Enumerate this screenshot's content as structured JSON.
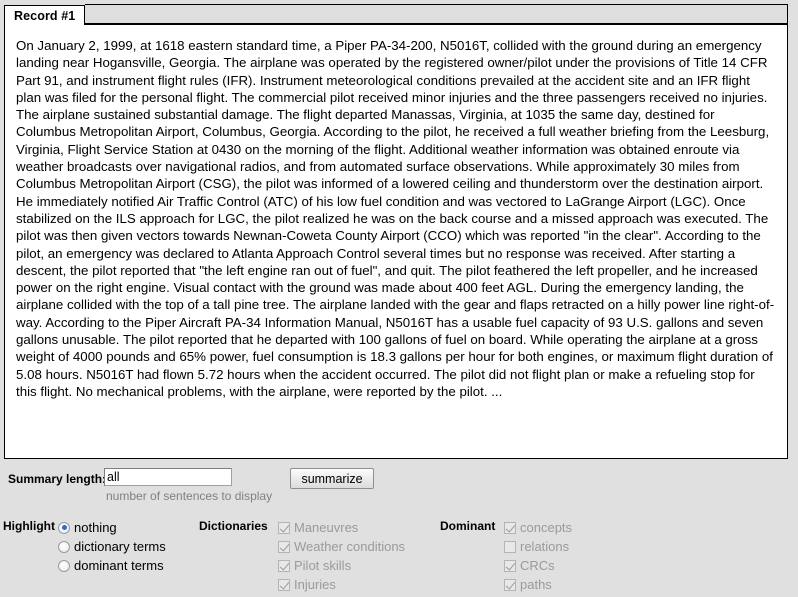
{
  "tab": {
    "label": "Record #1"
  },
  "record": {
    "text": "On January 2, 1999, at 1618 eastern standard time, a Piper PA-34-200, N5016T, collided with the ground during an emergency landing near Hogansville, Georgia. The airplane was operated by the registered owner/pilot under the provisions of Title 14 CFR Part 91, and instrument flight rules (IFR). Instrument meteorological conditions prevailed at the accident site and an IFR flight plan was filed for the personal flight. The commercial pilot received minor injuries and the three passengers received no injuries. The airplane sustained substantial damage. The flight departed Manassas, Virginia, at 1035 the same day, destined for Columbus Metropolitan Airport, Columbus, Georgia. According to the pilot, he received a full weather briefing from the Leesburg, Virginia, Flight Service Station at 0430 on the morning of the flight. Additional weather information was obtained enroute via weather broadcasts over navigational radios, and from automated surface observations. While approximately 30 miles from Columbus Metropolitan Airport (CSG), the pilot was informed of a lowered ceiling and thunderstorm over the destination airport. He immediately notified Air Traffic Control (ATC) of his low fuel condition and was vectored to LaGrange Airport (LGC). Once stabilized on the ILS approach for LGC, the pilot realized he was on the back course and a missed approach was executed. The pilot was then given vectors towards Newnan-Coweta County Airport (CCO) which was reported \"in the clear\". According to the pilot, an emergency was declared to Atlanta Approach Control several times but no response was received. After starting a descent, the pilot reported that \"the left engine ran out of fuel\", and quit. The pilot feathered the left propeller, and he increased power on the right engine. Visual contact with the ground was made about 400 feet AGL. During the emergency landing, the airplane collided with the top of a tall pine tree. The airplane landed with the gear and flaps retracted on a hilly power line right-of-way. According to the Piper Aircraft PA-34 Information Manual, N5016T has a usable fuel capacity of 93 U.S. gallons and seven gallons unusable. The pilot reported that he departed with 100 gallons of fuel on board. While operating the airplane at a gross weight of 4000 pounds and 65% power, fuel consumption is 18.3 gallons per hour for both engines, or maximum flight duration of 5.08 hours. N5016T had flown 5.72 hours when the accident occurred. The pilot did not flight plan or make a refueling stop for this flight. No mechanical problems, with the airplane, were reported by the pilot. ..."
  },
  "summary": {
    "length_label": "Summary length:",
    "length_value": "all",
    "length_placeholder": "",
    "hint": "number of sentences to display",
    "summarize_button": "summarize"
  },
  "highlight": {
    "title": "Highlight",
    "options": [
      {
        "label": "nothing",
        "checked": true
      },
      {
        "label": "dictionary terms",
        "checked": false
      },
      {
        "label": "dominant terms",
        "checked": false
      }
    ]
  },
  "dictionaries": {
    "title": "Dictionaries",
    "options": [
      {
        "label": "Maneuvres",
        "checked": true,
        "disabled": true
      },
      {
        "label": "Weather conditions",
        "checked": true,
        "disabled": true
      },
      {
        "label": "Pilot skills",
        "checked": true,
        "disabled": true
      },
      {
        "label": "Injuries",
        "checked": true,
        "disabled": true
      }
    ]
  },
  "dominant": {
    "title": "Dominant",
    "options": [
      {
        "label": "concepts",
        "checked": true,
        "disabled": true
      },
      {
        "label": "relations",
        "checked": false,
        "disabled": true
      },
      {
        "label": "CRCs",
        "checked": true,
        "disabled": true
      },
      {
        "label": "paths",
        "checked": true,
        "disabled": true
      }
    ]
  },
  "colors": {
    "background": "#e0e0e0",
    "panel": "#ffffff",
    "border": "#000000",
    "disabled_text": "#9a9a9a",
    "hint_text": "#808080",
    "radio_accent": "#2a6ec4"
  }
}
